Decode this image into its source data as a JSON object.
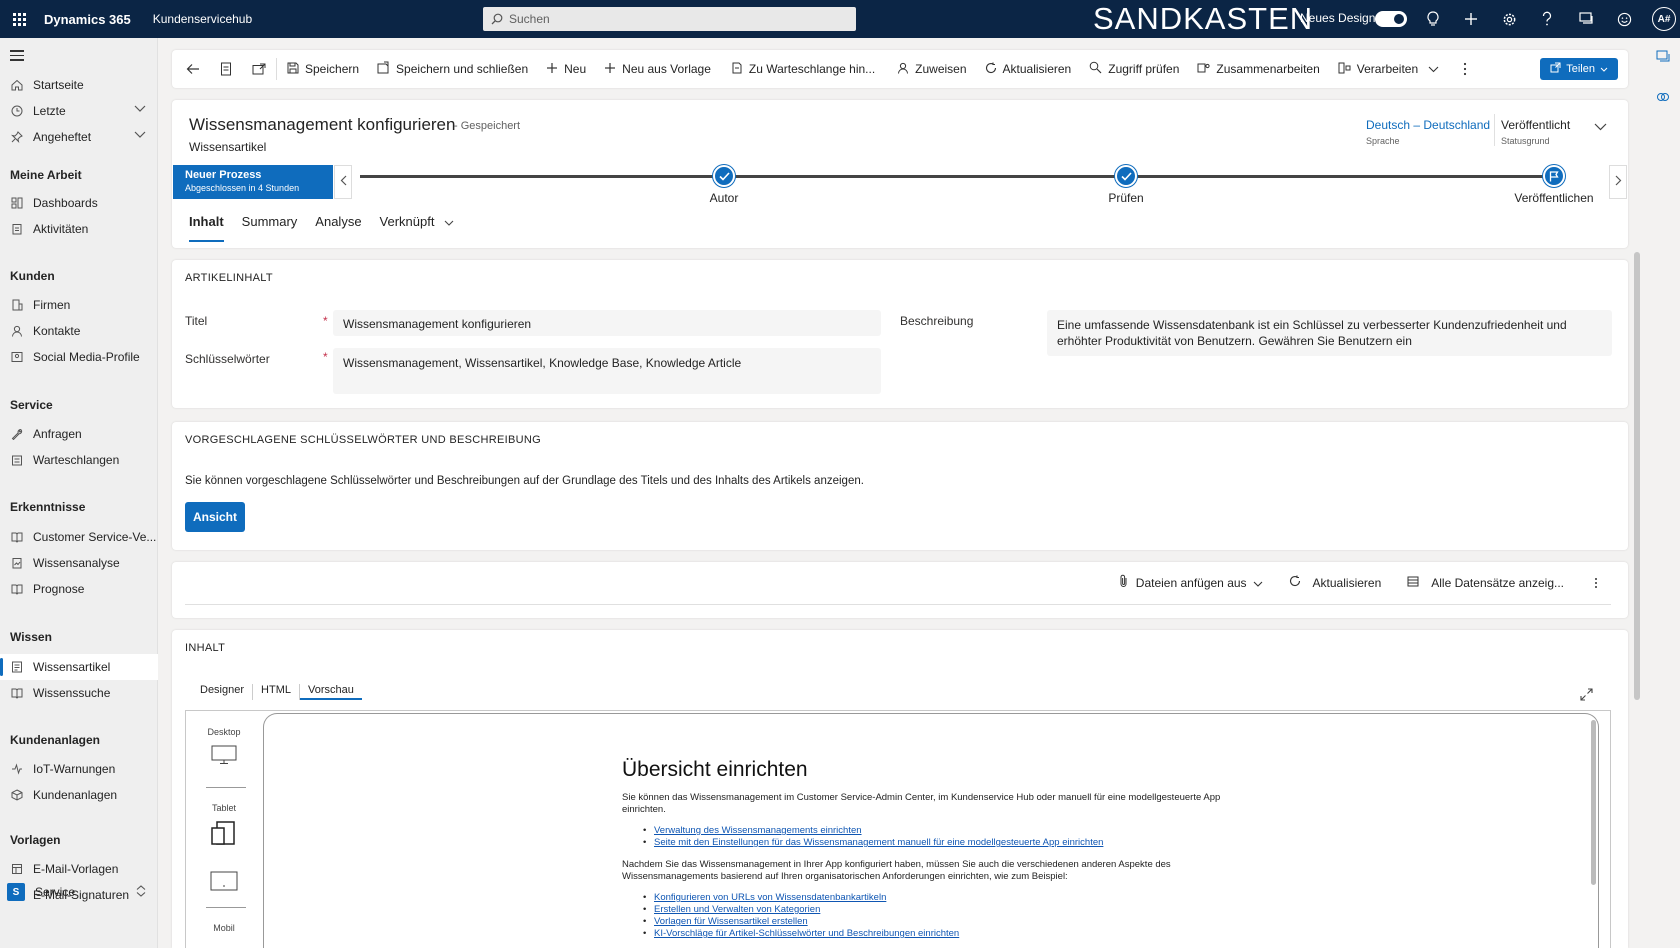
{
  "topbar": {
    "app_name": "Dynamics 365",
    "area_name": "Kundenservicehub",
    "search_placeholder": "Suchen",
    "environment": "SANDKASTEN",
    "new_design_label": "Neues Design",
    "new_design_on": true,
    "user_initials": "A#"
  },
  "sidebar": {
    "items_top": [
      {
        "label": "Startseite",
        "icon": "home-icon"
      },
      {
        "label": "Letzte",
        "icon": "clock-icon",
        "expandable": true
      },
      {
        "label": "Angeheftet",
        "icon": "pin-icon",
        "expandable": true
      }
    ],
    "groups": [
      {
        "title": "Meine Arbeit",
        "items": [
          {
            "label": "Dashboards"
          },
          {
            "label": "Aktivitäten"
          }
        ]
      },
      {
        "title": "Kunden",
        "items": [
          {
            "label": "Firmen"
          },
          {
            "label": "Kontakte"
          },
          {
            "label": "Social Media-Profile"
          }
        ]
      },
      {
        "title": "Service",
        "items": [
          {
            "label": "Anfragen"
          },
          {
            "label": "Warteschlangen"
          }
        ]
      },
      {
        "title": "Erkenntnisse",
        "items": [
          {
            "label": "Customer Service-Ve..."
          },
          {
            "label": "Wissensanalyse"
          },
          {
            "label": "Prognose"
          }
        ]
      },
      {
        "title": "Wissen",
        "items": [
          {
            "label": "Wissensartikel",
            "active": true
          },
          {
            "label": "Wissenssuche"
          }
        ]
      },
      {
        "title": "Kundenanlagen",
        "items": [
          {
            "label": "IoT-Warnungen"
          },
          {
            "label": "Kundenanlagen"
          }
        ]
      },
      {
        "title": "Vorlagen",
        "items": [
          {
            "label": "E-Mail-Vorlagen"
          },
          {
            "label": "E-Mail-Signaturen"
          }
        ]
      }
    ],
    "area_switch": {
      "badge": "S",
      "label": "Service"
    }
  },
  "commandbar": {
    "save": "Speichern",
    "save_close": "Speichern und schließen",
    "new": "Neu",
    "new_from_template": "Neu aus Vorlage",
    "add_to_queue": "Zu Warteschlange hin...",
    "assign": "Zuweisen",
    "refresh": "Aktualisieren",
    "check_access": "Zugriff prüfen",
    "collaborate": "Zusammenarbeiten",
    "process": "Verarbeiten",
    "share": "Teilen"
  },
  "record": {
    "title": "Wissensmanagement konfigurieren",
    "saved_state": "- Gespeichert",
    "entity": "Wissensartikel",
    "language_value": "Deutsch – Deutschland",
    "language_label": "Sprache",
    "status_value": "Veröffentlicht",
    "status_label": "Statusgrund"
  },
  "process": {
    "name": "Neuer Prozess",
    "status": "Abgeschlossen in 4 Stunden",
    "stages": [
      {
        "label": "Autor",
        "state": "done"
      },
      {
        "label": "Prüfen",
        "state": "done"
      },
      {
        "label": "Veröffentlichen",
        "state": "active"
      }
    ]
  },
  "tabs": [
    "Inhalt",
    "Summary",
    "Analyse",
    "Verknüpft"
  ],
  "article_content": {
    "section_title": "ARTIKELINHALT",
    "title_label": "Titel",
    "title_value": "Wissensmanagement konfigurieren",
    "keywords_label": "Schlüsselwörter",
    "keywords_value": "Wissensmanagement, Wissensartikel, Knowledge Base, Knowledge Article",
    "description_label": "Beschreibung",
    "description_value": "Eine umfassende Wissensdatenbank ist ein Schlüssel zu verbesserter Kundenzufriedenheit und erhöhter Produktivität von Benutzern. Gewähren Sie Benutzern ein",
    "required_marker": "*"
  },
  "suggestions": {
    "section_title": "VORGESCHLAGENE SCHLÜSSELWÖRTER UND BESCHREIBUNG",
    "text": "Sie können vorgeschlagene Schlüsselwörter und Beschreibungen auf der Grundlage des Titels und des Inhalts des Artikels anzeigen.",
    "button": "Ansicht"
  },
  "attachments": {
    "attach_label": "Dateien anfügen aus",
    "refresh_label": "Aktualisieren",
    "show_all_label": "Alle Datensätze anzeig..."
  },
  "content": {
    "section_title": "INHALT",
    "editor_tabs": [
      "Designer",
      "HTML",
      "Vorschau"
    ],
    "active_editor_tab": "Vorschau",
    "devices": [
      "Desktop",
      "Tablet",
      "Mobil"
    ],
    "doc_heading": "Übersicht einrichten",
    "doc_intro": "Sie können das Wissensmanagement im Customer Service-Admin Center, im Kundenservice Hub oder manuell für eine modellgesteuerte App einrichten.",
    "doc_links_1": [
      "Verwaltung des Wissensmanagements einrichten",
      "Seite mit den Einstellungen für das Wissensmanagement manuell für eine modellgesteuerte App einrichten"
    ],
    "doc_para_2": "Nachdem Sie das Wissensmanagement in Ihrer App konfiguriert haben, müssen Sie auch die verschiedenen anderen Aspekte des Wissensmanagements basierend auf Ihren organisatorischen Anforderungen einrichten, wie zum Beispiel:",
    "doc_links_2": [
      "Konfigurieren von URLs von Wissensdatenbankartikeln",
      "Erstellen und Verwalten von Kategorien",
      "Vorlagen für Wissensartikel erstellen",
      "KI-Vorschläge für Artikel-Schlüsselwörter und Beschreibungen einrichten"
    ]
  },
  "colors": {
    "topbar": "#0b2545",
    "accent": "#0f6cbd",
    "required": "#c4314b"
  }
}
